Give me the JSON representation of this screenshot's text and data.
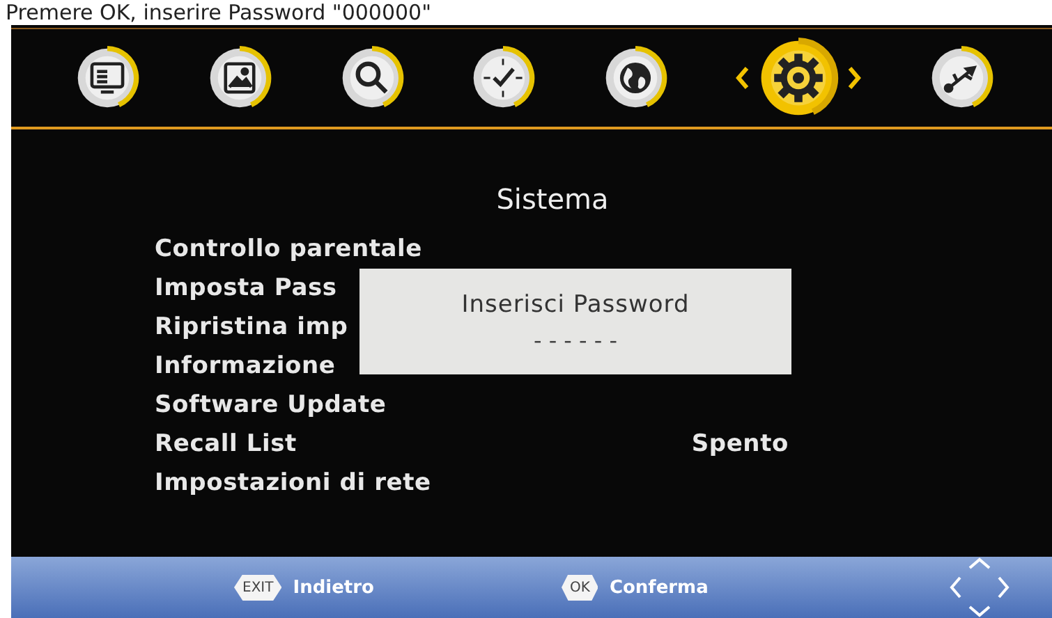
{
  "caption": "Premere OK, inserire Password \"000000\"",
  "menu_icons": [
    {
      "selected": false
    },
    {
      "selected": false
    },
    {
      "selected": false
    },
    {
      "selected": false
    },
    {
      "selected": false
    },
    {
      "selected": true
    },
    {
      "selected": false
    }
  ],
  "title": "Sistema",
  "items": [
    {
      "label": "Controllo parentale"
    },
    {
      "label": "Imposta Pass"
    },
    {
      "label": "Ripristina imp"
    },
    {
      "label": "Informazione"
    },
    {
      "label": "Software Update"
    },
    {
      "label": "Recall List",
      "value": "Spento"
    },
    {
      "label": "Impostazioni di rete"
    }
  ],
  "dialog": {
    "title": "Inserisci Password",
    "value": "- - - - - -"
  },
  "hints": [
    {
      "key": "EXIT",
      "label": "Indietro"
    },
    {
      "key": "OK",
      "label": "Conferma"
    }
  ]
}
